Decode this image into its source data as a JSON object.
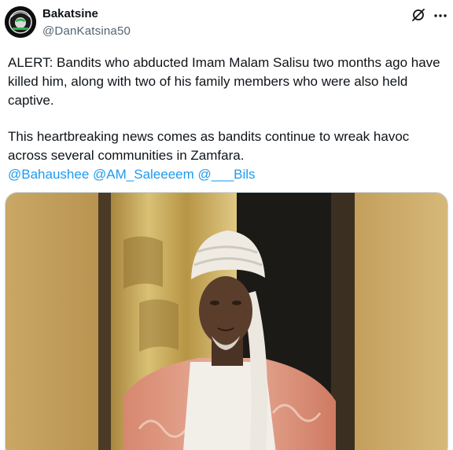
{
  "tweet": {
    "author": {
      "display_name": "Bakatsine",
      "handle": "@DanKatsina50"
    },
    "paragraph_1": "ALERT: Bandits who abducted Imam Malam Salisu two months ago have killed him, along with two of his family members who were also held captive.",
    "paragraph_2": "This heartbreaking news comes as bandits continue to wreak havoc across several communities in Zamfara.",
    "mentions": [
      "@Bahaushee",
      "@AM_Saleeeem",
      "@___Bils"
    ],
    "icons": {
      "grok": "grok-icon",
      "more": "more-horizontal-icon"
    },
    "colors": {
      "link": "#1d9bf0",
      "text": "#0f1419",
      "secondary": "#536471"
    }
  }
}
